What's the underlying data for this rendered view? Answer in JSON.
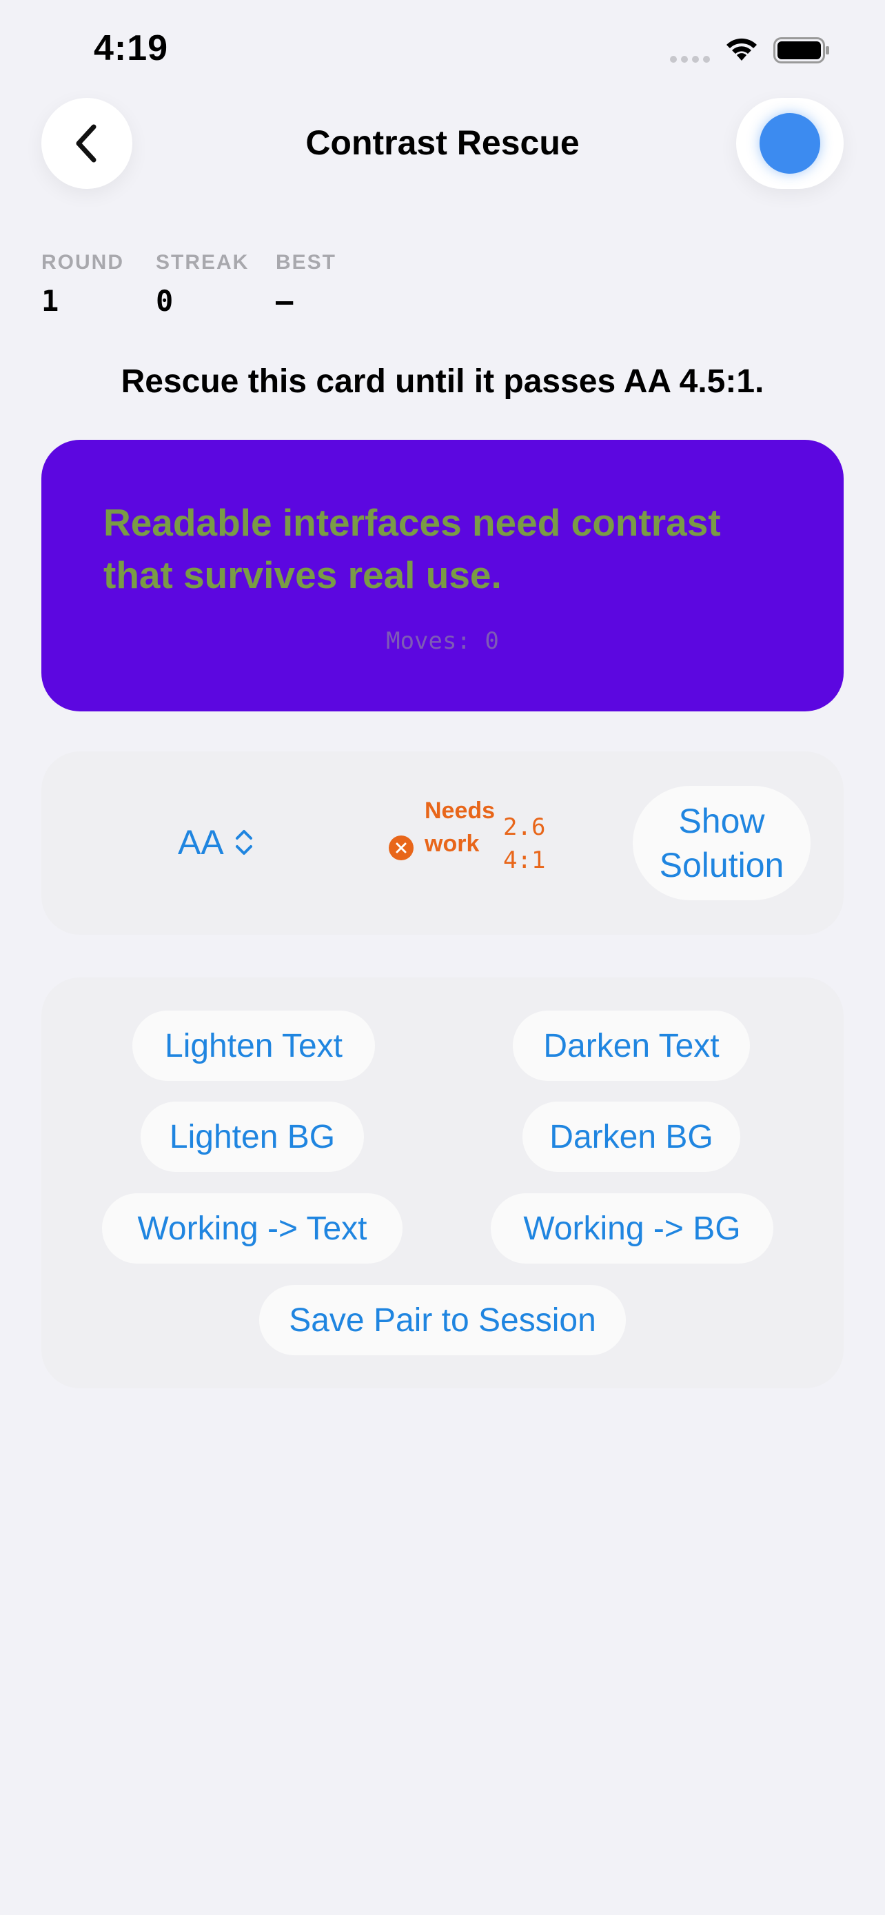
{
  "status_bar": {
    "time": "4:19",
    "icons": [
      "cellular-signal-icon",
      "wifi-icon",
      "battery-icon"
    ]
  },
  "nav": {
    "back_icon": "chevron-left-icon",
    "title": "Contrast Rescue",
    "profile_color": "#3c8bf0"
  },
  "stats": [
    {
      "label": "ROUND",
      "value": "1"
    },
    {
      "label": "STREAK",
      "value": "0"
    },
    {
      "label": "BEST",
      "value": "—"
    }
  ],
  "prompt": "Rescue this card until it passes AA 4.5:1.",
  "preview": {
    "text": "Readable interfaces need contrast that survives real use.",
    "moves": "Moves: 0",
    "background_color": "#5c07e0",
    "text_color": "#7a9b46"
  },
  "status": {
    "level": "AA",
    "result_label": "Needs work",
    "ratio": "2.64:1",
    "result_icon": "x-circle-icon",
    "show_solution": "Show Solution"
  },
  "controls": {
    "lighten_text": "Lighten Text",
    "darken_text": "Darken Text",
    "lighten_bg": "Lighten BG",
    "darken_bg": "Darken BG",
    "working_to_text": "Working -> Text",
    "working_to_bg": "Working -> BG",
    "save_pair": "Save Pair to Session"
  },
  "colors": {
    "accent": "#1f85e0",
    "warning": "#e8661a",
    "background": "#f2f2f7"
  }
}
